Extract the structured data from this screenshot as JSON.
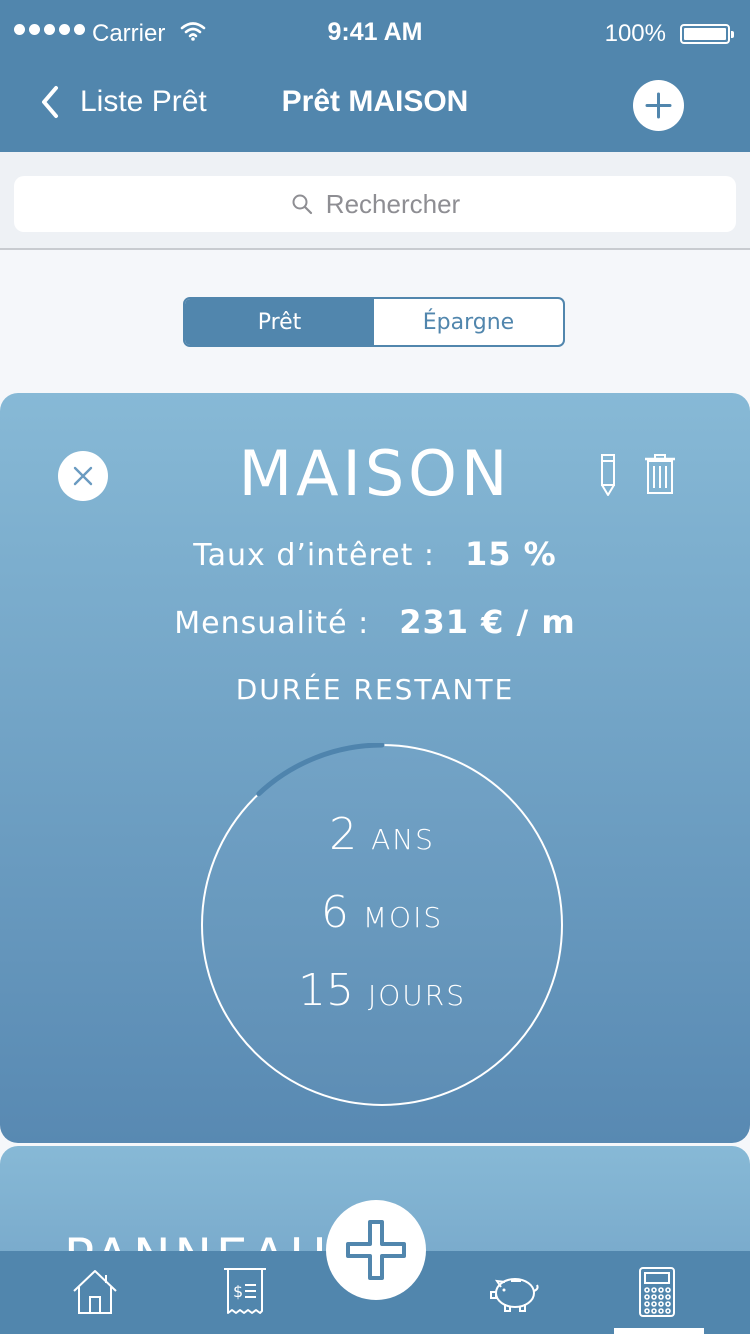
{
  "status_bar": {
    "carrier": "Carrier",
    "time": "9:41 AM",
    "battery": "100%"
  },
  "nav": {
    "back_label": "Liste Prêt",
    "title": "Prêt MAISON"
  },
  "search": {
    "placeholder": "Rechercher"
  },
  "segment": {
    "options": [
      "Prêt",
      "Épargne"
    ],
    "selected": "Prêt"
  },
  "loan_card": {
    "name": "MAISON",
    "rate_label": "Taux d’intêret :",
    "rate_value": "15 %",
    "monthly_label": "Mensualité :",
    "monthly_value": "231 € / m",
    "remaining_label": "DURÉE RESTANTE",
    "years_value": "2",
    "years_unit": "ANS",
    "months_value": "6",
    "months_unit": "MOIS",
    "days_value": "15",
    "days_unit": "JOURS",
    "progress_fraction": 0.12
  },
  "next_card": {
    "name": "PANNEAUX"
  },
  "tab_bar": {
    "items": [
      "home-icon",
      "bill-icon",
      "piggy-bank-icon",
      "calculator-icon"
    ],
    "selected": "calculator-icon"
  },
  "colors": {
    "primary": "#5186ad",
    "card_top": "#87b9d6",
    "card_bottom": "#5889b2",
    "background": "#f5f7fa"
  }
}
